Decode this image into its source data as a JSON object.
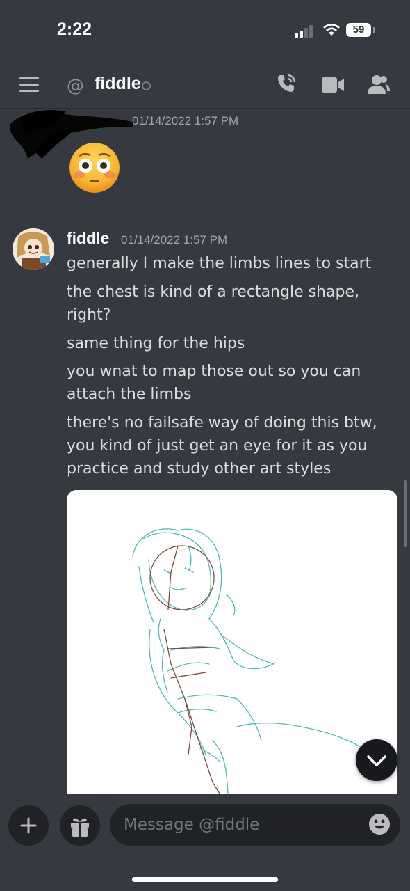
{
  "status_bar": {
    "time": "2:22",
    "battery": "59"
  },
  "header": {
    "channel_prefix": "@",
    "channel_name": "fiddle"
  },
  "messages": [
    {
      "timestamp": "01/14/2022 1:57 PM",
      "emoji": "flushed-face-emoji"
    },
    {
      "author": "fiddle",
      "timestamp": "01/14/2022 1:57 PM",
      "lines": [
        "generally I make the limbs lines to start",
        "the chest is kind of a rectangle shape, right?",
        "same thing for the hips",
        "you wnat to map those out so you can attach the limbs",
        "there's no failsafe way of doing this btw, you kind of just get an eye for it as you practice and study other art styles"
      ]
    }
  ],
  "composer": {
    "placeholder": "Message @fiddle"
  },
  "colors": {
    "background": "#36393f",
    "input": "#202225",
    "sketch_teal": "#4fb8b5",
    "sketch_brown": "#7a4a3a"
  }
}
